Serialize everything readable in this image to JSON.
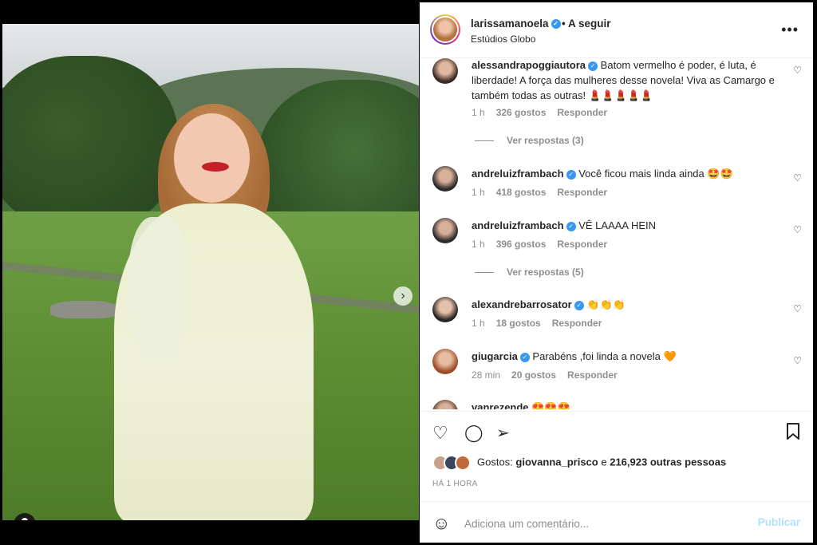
{
  "post": {
    "username": "larissamanoela",
    "follow_label": "• A seguir",
    "location": "Estúdios Globo",
    "more_icon": "•••"
  },
  "comments": [
    {
      "username": "alessandrapoggiautora",
      "text": "Batom vermelho é poder, é luta, é liberdade! A força das mulheres desse novela! Viva as Camargo e também todas as outras! 💄💄💄💄💄",
      "time": "1 h",
      "likes": "326 gostos",
      "reply": "Responder",
      "view_replies": "Ver respostas (3)"
    },
    {
      "username": "andreluizframbach",
      "text": "Você ficou mais linda ainda 🤩🤩",
      "time": "1 h",
      "likes": "418 gostos",
      "reply": "Responder"
    },
    {
      "username": "andreluizframbach",
      "text": "VÊ LAAAA HEIN",
      "time": "1 h",
      "likes": "396 gostos",
      "reply": "Responder",
      "view_replies": "Ver respostas (5)"
    },
    {
      "username": "alexandrebarrosator",
      "text": "👏👏👏",
      "time": "1 h",
      "likes": "18 gostos",
      "reply": "Responder"
    },
    {
      "username": "giugarcia",
      "text": "Parabéns ,foi linda a novela 🧡",
      "time": "28 min",
      "likes": "20 gostos",
      "reply": "Responder"
    },
    {
      "username": "vanrezende",
      "text": "😍😍😍"
    }
  ],
  "likes": {
    "prefix": "Gostos:",
    "first_user": "giovanna_prisco",
    "middle": "e",
    "others": "216,923 outras pessoas"
  },
  "timestamp": "HÁ 1 HORA",
  "add_comment": {
    "placeholder": "Adiciona um comentário...",
    "publish_label": "Publicar"
  },
  "colors": {
    "verified": "#3897f0",
    "publish_disabled": "#b2dffc"
  }
}
